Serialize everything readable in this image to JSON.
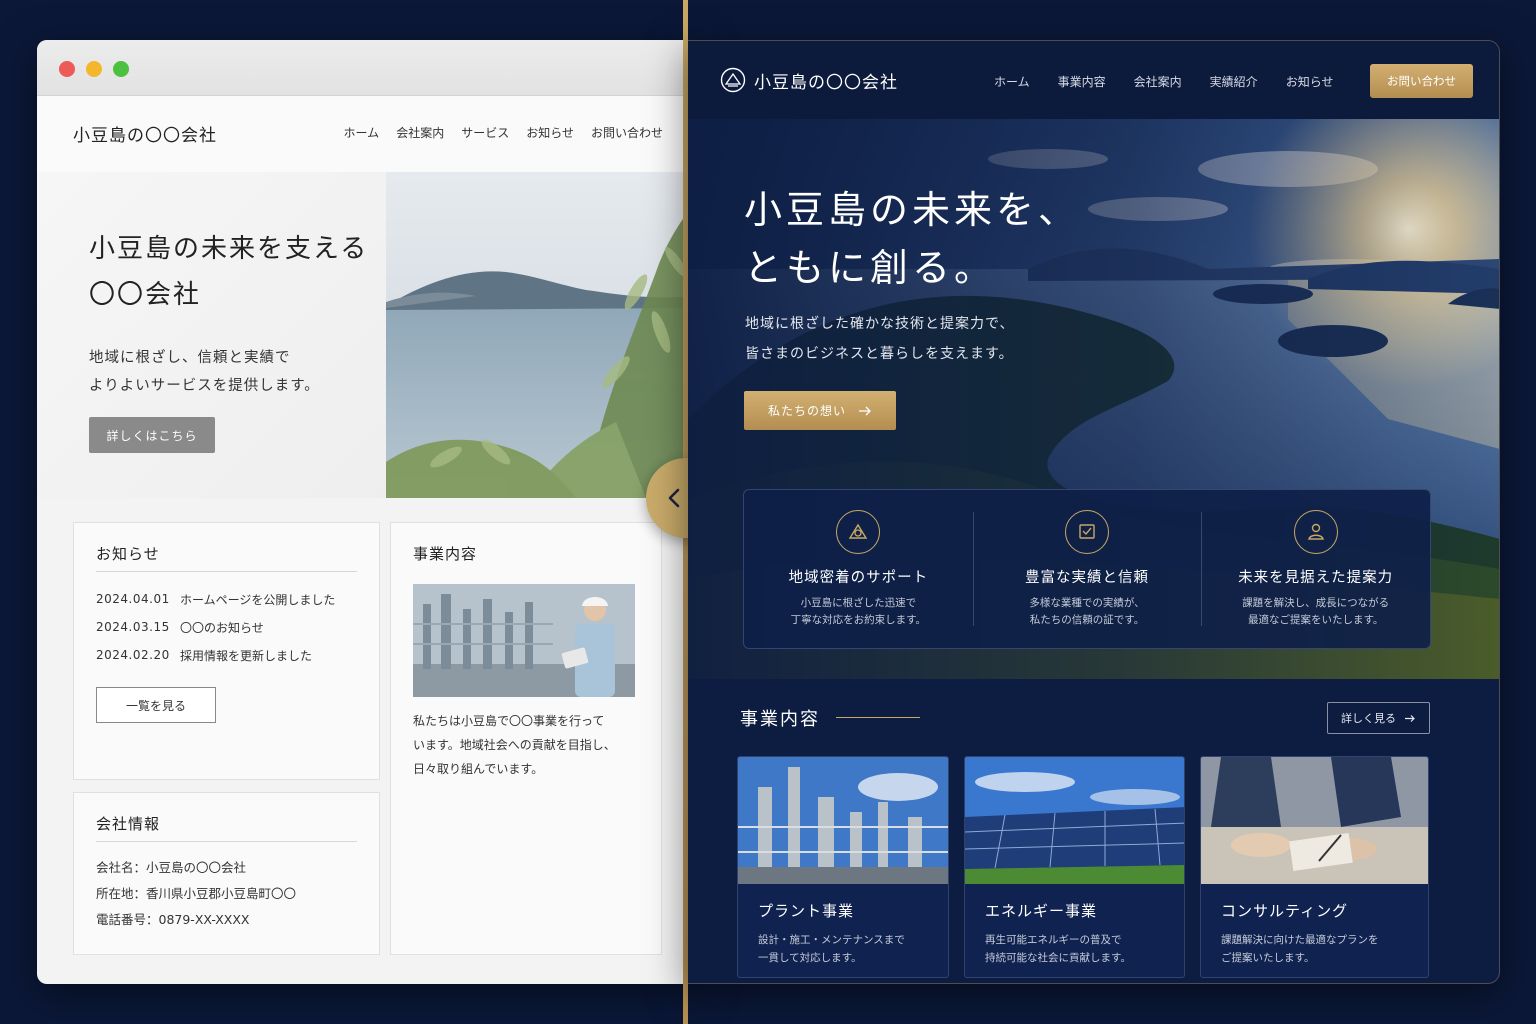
{
  "before": {
    "logo": "小豆島の〇〇会社",
    "nav": [
      "ホーム",
      "会社案内",
      "サービス",
      "お知らせ",
      "お問い合わせ"
    ],
    "hero": {
      "title_line1": "小豆島の未来を支える",
      "title_line2": "〇〇会社",
      "sub_line1": "地域に根ざし、信頼と実績で",
      "sub_line2": "よりよいサービスを提供します。",
      "button": "詳しくはこちら"
    },
    "news": {
      "title": "お知らせ",
      "items": [
        {
          "date": "2024.04.01",
          "text": "ホームページを公開しました"
        },
        {
          "date": "2024.03.15",
          "text": "〇〇のお知らせ"
        },
        {
          "date": "2024.02.20",
          "text": "採用情報を更新しました"
        }
      ],
      "button": "一覧を見る"
    },
    "business": {
      "title": "事業内容",
      "text_line1": "私たちは小豆島で〇〇事業を行って",
      "text_line2": "います。地域社会への貢献を目指し、",
      "text_line3": "日々取り組んでいます。"
    },
    "company": {
      "title": "会社情報",
      "name": "会社名：小豆島の〇〇会社",
      "address": "所在地：香川県小豆郡小豆島町〇〇",
      "phone": "電話番号：0879-XX-XXXX"
    }
  },
  "after": {
    "logo": "小豆島の〇〇会社",
    "nav": [
      "ホーム",
      "事業内容",
      "会社案内",
      "実績紹介",
      "お知らせ"
    ],
    "cta": "お問い合わせ",
    "hero": {
      "title_line1": "小豆島の未来を、",
      "title_line2": "ともに創る。",
      "sub_line1": "地域に根ざした確かな技術と提案力で、",
      "sub_line2": "皆さまのビジネスと暮らしを支えます。",
      "button": "私たちの想い"
    },
    "features": [
      {
        "title": "地域密着のサポート",
        "desc1": "小豆島に根ざした迅速で",
        "desc2": "丁寧な対応をお約束します。"
      },
      {
        "title": "豊富な実績と信頼",
        "desc1": "多様な業種での実績が、",
        "desc2": "私たちの信頼の証です。"
      },
      {
        "title": "未来を見据えた提案力",
        "desc1": "課題を解決し、成長につながる",
        "desc2": "最適なご提案をいたします。"
      }
    ],
    "section": {
      "title": "事業内容",
      "more": "詳しく見る"
    },
    "services": [
      {
        "title": "プラント事業",
        "desc1": "設計・施工・メンテナンスまで",
        "desc2": "一貫して対応します。"
      },
      {
        "title": "エネルギー事業",
        "desc1": "再生可能エネルギーの普及で",
        "desc2": "持続可能な社会に貢献します。"
      },
      {
        "title": "コンサルティング",
        "desc1": "課題解決に向けた最適なプランを",
        "desc2": "ご提案いたします。"
      }
    ]
  },
  "colors": {
    "navy": "#0b1838",
    "gold": "#c9a865",
    "light_bg": "#f3f3f3"
  },
  "icons": [
    "arrow-right-icon",
    "compare-arrows-icon",
    "logo-mark-icon",
    "support-icon",
    "trust-icon",
    "proposal-icon"
  ]
}
